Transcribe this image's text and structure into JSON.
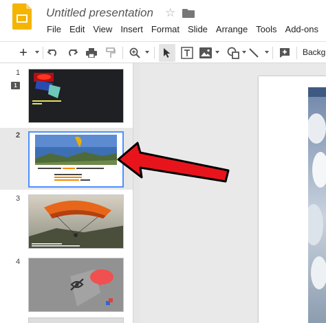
{
  "app": {
    "title": "Untitled presentation",
    "star_glyph": "☆",
    "logo_icon": "google-slides-logo-icon",
    "accent_color": "#f4b400"
  },
  "menu": [
    "File",
    "Edit",
    "View",
    "Insert",
    "Format",
    "Slide",
    "Arrange",
    "Tools",
    "Add-ons"
  ],
  "toolbar": {
    "new_slide_glyph": "+",
    "background_label": "Backgr",
    "icons": [
      "plus-icon",
      "undo-icon",
      "redo-icon",
      "print-icon",
      "paint-format-icon",
      "zoom-icon",
      "select-icon",
      "text-box-icon",
      "image-icon",
      "shape-icon",
      "line-icon",
      "add-comment-icon"
    ]
  },
  "filmstrip": {
    "slides": [
      {
        "number": "1"
      },
      {
        "number": "2",
        "selected": true
      },
      {
        "number": "3"
      },
      {
        "number": "4"
      }
    ],
    "selection_color": "#4d90fe"
  },
  "annotation": {
    "arrow_color": "#e8141c"
  }
}
